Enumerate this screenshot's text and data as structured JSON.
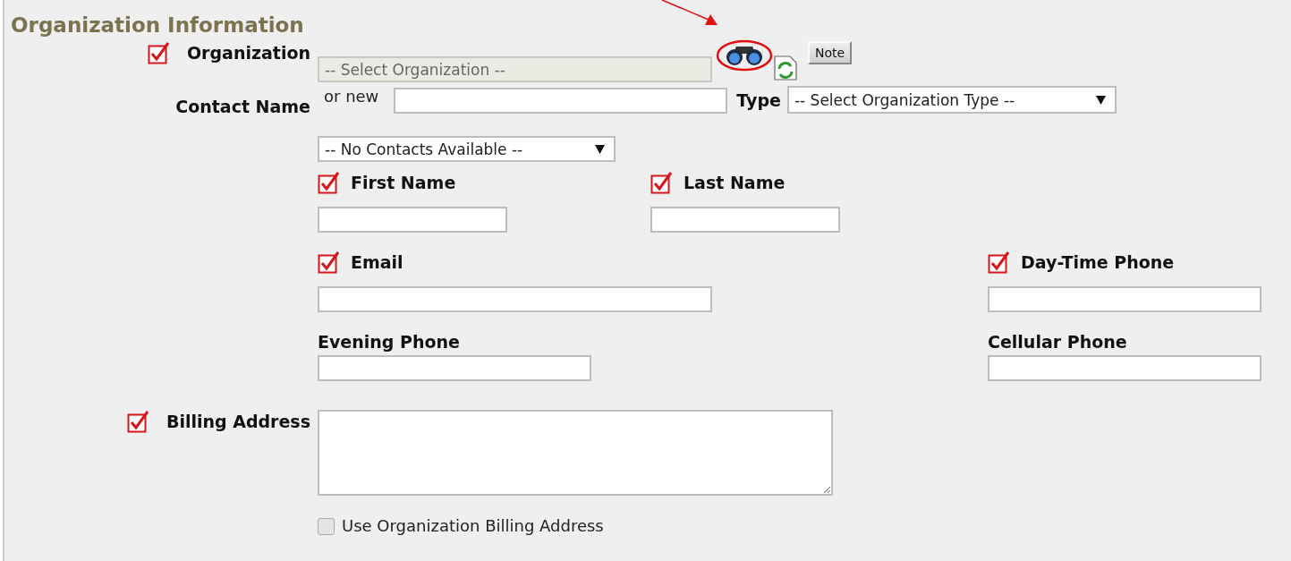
{
  "title": "Organization Information",
  "organization": {
    "label": "Organization",
    "required": true,
    "placeholder": "-- Select Organization --",
    "disabled": true,
    "note_button": "Note"
  },
  "contact": {
    "label": "Contact Name",
    "or_new": "or new",
    "type_label": "Type",
    "type_select": "-- Select Organization Type --",
    "contacts_select": "-- No Contacts Available --"
  },
  "field_rows": [
    {
      "kind": "pair",
      "fields": [
        {
          "label": "First Name",
          "required": true
        },
        {
          "label": "Last Name",
          "required": true
        }
      ]
    },
    {
      "kind": "wide",
      "fields": [
        {
          "label": "Email",
          "required": true
        },
        {
          "label": "Day-Time Phone",
          "required": true
        }
      ]
    },
    {
      "kind": "wide",
      "fields": [
        {
          "label": "Evening Phone",
          "required": false
        },
        {
          "label": "Cellular Phone",
          "required": false
        }
      ]
    }
  ],
  "billing": {
    "label": "Billing Address",
    "required": true
  },
  "use_org_billing": {
    "label": "Use Organization Billing Address",
    "checked": false
  }
}
